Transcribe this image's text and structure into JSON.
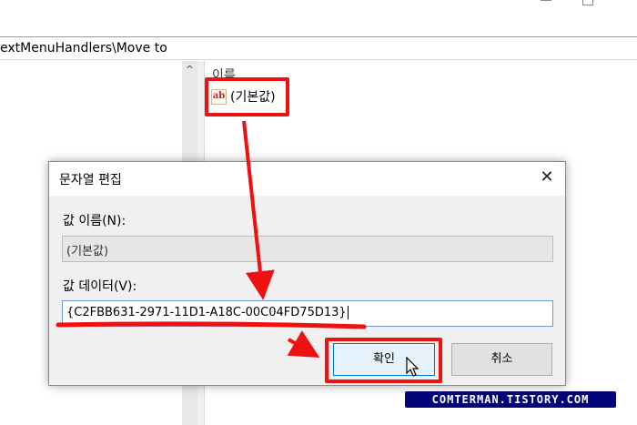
{
  "registry_editor": {
    "address_path": "extMenuHandlers\\Move to",
    "values_column_header": "이름",
    "value_icon_text": "ab",
    "selected_value_name": "(기본값)",
    "scroll_up_glyph": "^"
  },
  "dialog": {
    "title": "문자열 편집",
    "close_glyph": "✕",
    "value_name_label": "값 이름(N):",
    "value_name": "(기본값)",
    "value_data_label": "값 데이터(V):",
    "value_data": "{C2FBB631-2971-11D1-A18C-00C04FD75D13}",
    "ok_label": "확인",
    "cancel_label": "취소"
  },
  "annotations": {
    "highlight_color": "#ee1111"
  },
  "watermark": {
    "text": "COMTERMAN.TISTORY.COM"
  }
}
